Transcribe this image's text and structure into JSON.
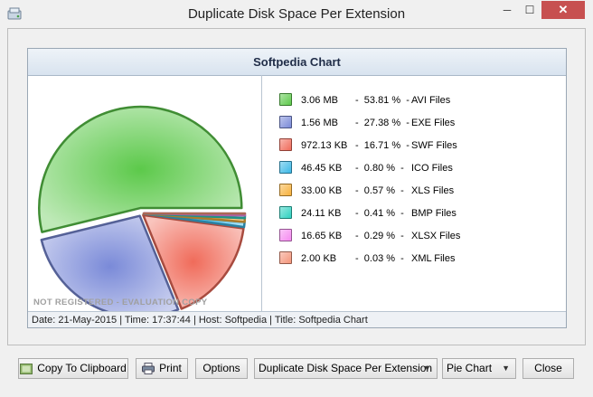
{
  "window": {
    "title": "Duplicate Disk Space Per Extension",
    "min_glyph": "─",
    "max_glyph": "☐",
    "close_glyph": "✕"
  },
  "panel": {
    "title": "Softpedia Chart",
    "watermark": "NOT REGISTERED - EVALUATION COPY",
    "status": "Date: 21-May-2015 | Time: 17:37:44 | Host: Softpedia | Title: Softpedia Chart"
  },
  "chart_data": {
    "type": "pie",
    "title": "Softpedia Chart",
    "slices": [
      {
        "name": "AVI Files",
        "size": "3.06 MB",
        "percent": 53.81,
        "percent_label": "53.81 %",
        "color": "#5cc94a"
      },
      {
        "name": "EXE Files",
        "size": "1.56 MB",
        "percent": 27.38,
        "percent_label": "27.38 %",
        "color": "#7a8ad8"
      },
      {
        "name": "SWF Files",
        "size": "972.13 KB",
        "percent": 16.71,
        "percent_label": "16.71 %",
        "color": "#f06b5a"
      },
      {
        "name": "ICO Files",
        "size": "46.45 KB",
        "percent": 0.8,
        "percent_label": "0.80 %",
        "color": "#3cb8e6"
      },
      {
        "name": "XLS Files",
        "size": "33.00 KB",
        "percent": 0.57,
        "percent_label": "0.57 %",
        "color": "#f7b13c"
      },
      {
        "name": "BMP Files",
        "size": "24.11 KB",
        "percent": 0.41,
        "percent_label": "0.41 %",
        "color": "#2ed1c0"
      },
      {
        "name": "XLSX Files",
        "size": "16.65 KB",
        "percent": 0.29,
        "percent_label": "0.29 %",
        "color": "#f58af0"
      },
      {
        "name": "XML Files",
        "size": "2.00 KB",
        "percent": 0.03,
        "percent_label": "0.03 %",
        "color": "#f4957a"
      }
    ]
  },
  "toolbar": {
    "copy_label": "Copy To Clipboard",
    "print_label": "Print",
    "options_label": "Options",
    "report_select": "Duplicate Disk Space Per Extension",
    "chart_select": "Pie Chart",
    "close_label": "Close"
  }
}
